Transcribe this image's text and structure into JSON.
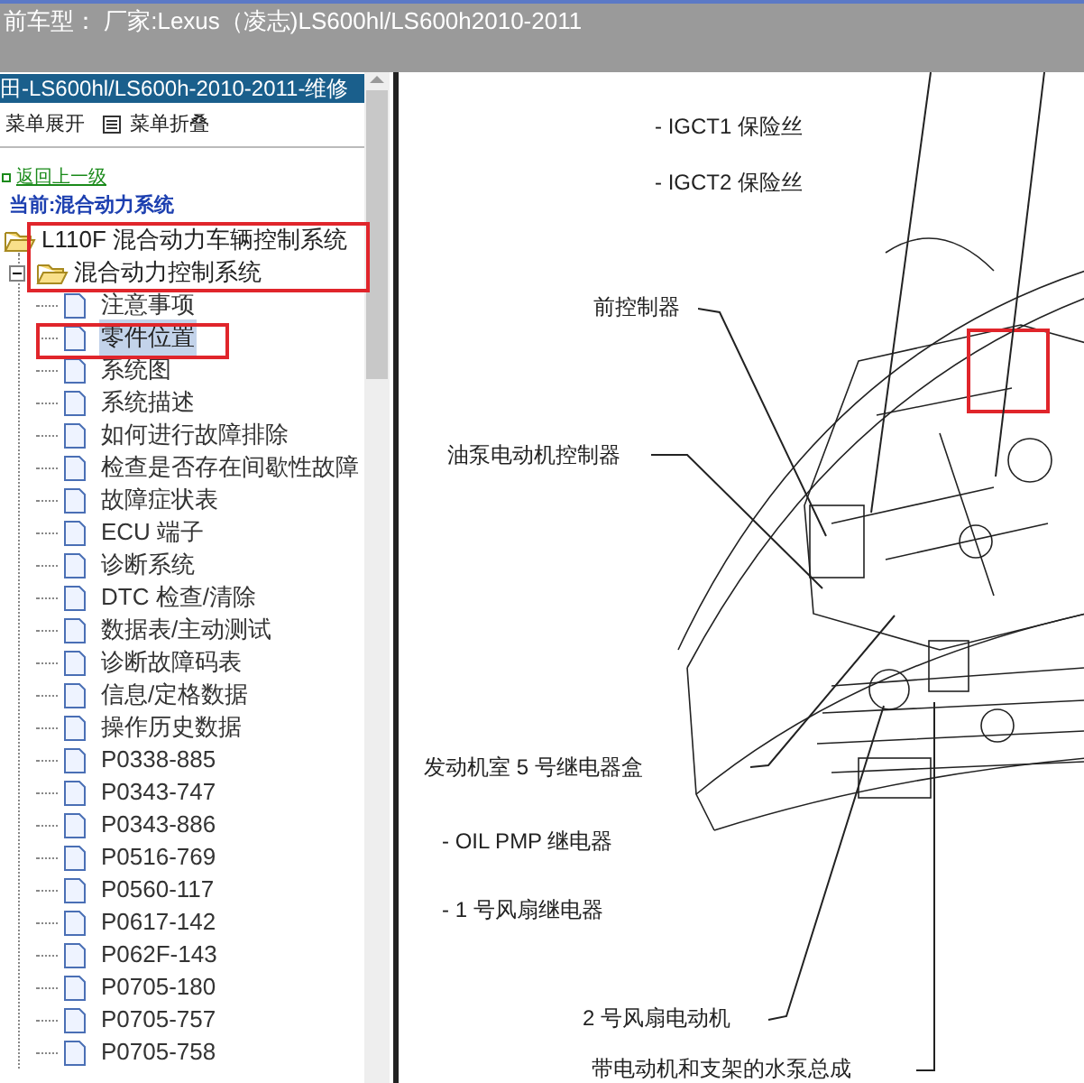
{
  "title_bar": {
    "text": "前车型： 厂家:Lexus（凌志)LS600hl/LS600h2010-2011"
  },
  "sidebar": {
    "header": "田-LS600hl/LS600h-2010-2011-维修",
    "toolbar": [
      {
        "label": "菜单展开"
      },
      {
        "label": "菜单折叠"
      }
    ],
    "back_link": "返回上一级",
    "current": "当前:混合动力系统",
    "tree": [
      {
        "kind": "folder",
        "label": "L110F 混合动力车辆控制系统",
        "expanded": true,
        "children": [
          {
            "kind": "folder",
            "label": "混合动力控制系统",
            "expanded": true,
            "children": [
              {
                "kind": "page",
                "label": "注意事项",
                "selected": false
              },
              {
                "kind": "page",
                "label": "零件位置",
                "selected": true
              },
              {
                "kind": "page",
                "label": "系统图",
                "selected": false
              },
              {
                "kind": "page",
                "label": "系统描述",
                "selected": false
              },
              {
                "kind": "page",
                "label": "如何进行故障排除",
                "selected": false
              },
              {
                "kind": "page",
                "label": "检查是否存在间歇性故障",
                "selected": false
              },
              {
                "kind": "page",
                "label": "故障症状表",
                "selected": false
              },
              {
                "kind": "page",
                "label": "ECU 端子",
                "selected": false
              },
              {
                "kind": "page",
                "label": "诊断系统",
                "selected": false
              },
              {
                "kind": "page",
                "label": "DTC 检查/清除",
                "selected": false
              },
              {
                "kind": "page",
                "label": "数据表/主动测试",
                "selected": false
              },
              {
                "kind": "page",
                "label": "诊断故障码表",
                "selected": false
              },
              {
                "kind": "page",
                "label": "信息/定格数据",
                "selected": false
              },
              {
                "kind": "page",
                "label": "操作历史数据",
                "selected": false
              },
              {
                "kind": "page",
                "label": "P0338-885",
                "selected": false
              },
              {
                "kind": "page",
                "label": "P0343-747",
                "selected": false
              },
              {
                "kind": "page",
                "label": "P0343-886",
                "selected": false
              },
              {
                "kind": "page",
                "label": "P0516-769",
                "selected": false
              },
              {
                "kind": "page",
                "label": "P0560-117",
                "selected": false
              },
              {
                "kind": "page",
                "label": "P0617-142",
                "selected": false
              },
              {
                "kind": "page",
                "label": "P062F-143",
                "selected": false
              },
              {
                "kind": "page",
                "label": "P0705-180",
                "selected": false
              },
              {
                "kind": "page",
                "label": "P0705-757",
                "selected": false
              },
              {
                "kind": "page",
                "label": "P0705-758",
                "selected": false
              }
            ]
          }
        ]
      }
    ]
  },
  "diagram": {
    "labels": [
      {
        "text": "- IGCT1 保险丝"
      },
      {
        "text": "- IGCT2 保险丝"
      },
      {
        "text": "前控制器"
      },
      {
        "text": "油泵电动机控制器"
      },
      {
        "text": "发动机室 5 号继电器盒"
      },
      {
        "text": "- OIL PMP 继电器"
      },
      {
        "text": "- 1 号风扇继电器"
      },
      {
        "text": "2 号风扇电动机"
      },
      {
        "text": "带电动机和支架的水泵总成"
      }
    ]
  }
}
